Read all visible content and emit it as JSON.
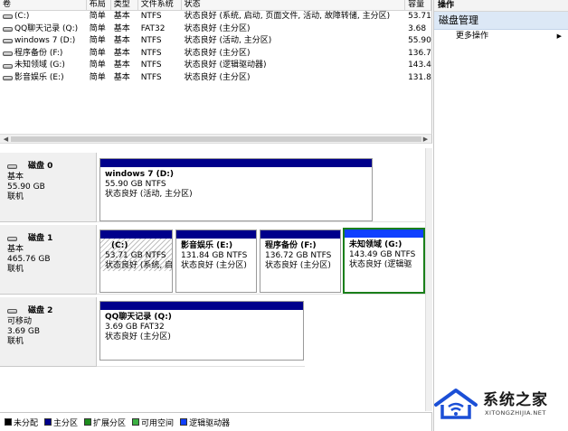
{
  "volume_table": {
    "columns": [
      "卷",
      "布局",
      "类型",
      "文件系统",
      "状态",
      "容量"
    ],
    "rows": [
      {
        "name": "(C:)",
        "layout": "简单",
        "type": "基本",
        "fs": "NTFS",
        "status": "状态良好 (系统, 启动, 页面文件, 活动, 故障转储, 主分区)",
        "capacity": "53.71"
      },
      {
        "name": "QQ聊天记录 (Q:)",
        "layout": "简单",
        "type": "基本",
        "fs": "FAT32",
        "status": "状态良好 (主分区)",
        "capacity": "3.68"
      },
      {
        "name": "windows 7 (D:)",
        "layout": "简单",
        "type": "基本",
        "fs": "NTFS",
        "status": "状态良好 (活动, 主分区)",
        "capacity": "55.90"
      },
      {
        "name": "程序备份 (F:)",
        "layout": "简单",
        "type": "基本",
        "fs": "NTFS",
        "status": "状态良好 (主分区)",
        "capacity": "136.7"
      },
      {
        "name": "未知领域 (G:)",
        "layout": "简单",
        "type": "基本",
        "fs": "NTFS",
        "status": "状态良好 (逻辑驱动器)",
        "capacity": "143.4"
      },
      {
        "name": "影音娱乐 (E:)",
        "layout": "简单",
        "type": "基本",
        "fs": "NTFS",
        "status": "状态良好 (主分区)",
        "capacity": "131.8"
      }
    ]
  },
  "scrollbar": {
    "left_arrow": "◀",
    "right_arrow": "▶"
  },
  "disks": [
    {
      "title": "磁盘 0",
      "kind": "基本",
      "size": "55.90 GB",
      "state": "联机",
      "partitions": [
        {
          "name": "windows 7  (D:)",
          "size": "55.90 GB NTFS",
          "status": "状态良好 (活动, 主分区)"
        }
      ]
    },
    {
      "title": "磁盘 1",
      "kind": "基本",
      "size": "465.76 GB",
      "state": "联机",
      "partitions": [
        {
          "name": "(C:)",
          "size": "53.71 GB NTFS",
          "status": "状态良好 (系统, 启"
        },
        {
          "name": "影音娱乐  (E:)",
          "size": "131.84 GB NTFS",
          "status": "状态良好 (主分区)"
        },
        {
          "name": "程序备份  (F:)",
          "size": "136.72 GB NTFS",
          "status": "状态良好 (主分区)"
        },
        {
          "name": "未知领域  (G:)",
          "size": "143.49 GB NTFS",
          "status": "状态良好 (逻辑驱"
        }
      ]
    },
    {
      "title": "磁盘 2",
      "kind": "可移动",
      "size": "3.69 GB",
      "state": "联机",
      "partitions": [
        {
          "name": "QQ聊天记录  (Q:)",
          "size": "3.69 GB FAT32",
          "status": "状态良好 (主分区)"
        }
      ]
    }
  ],
  "legend": [
    {
      "label": "未分配",
      "color": "#000000"
    },
    {
      "label": "主分区",
      "color": "#00008b"
    },
    {
      "label": "扩展分区",
      "color": "#1e8c1e"
    },
    {
      "label": "可用空间",
      "color": "#3cb043"
    },
    {
      "label": "逻辑驱动器",
      "color": "#1040ff"
    }
  ],
  "actions": {
    "header": "操作",
    "section": "磁盘管理",
    "items": [
      {
        "label": "更多操作",
        "caret": "▶"
      }
    ]
  },
  "watermark": {
    "text": "系统之家",
    "sub": "XITONGZHIJIA.NET"
  }
}
